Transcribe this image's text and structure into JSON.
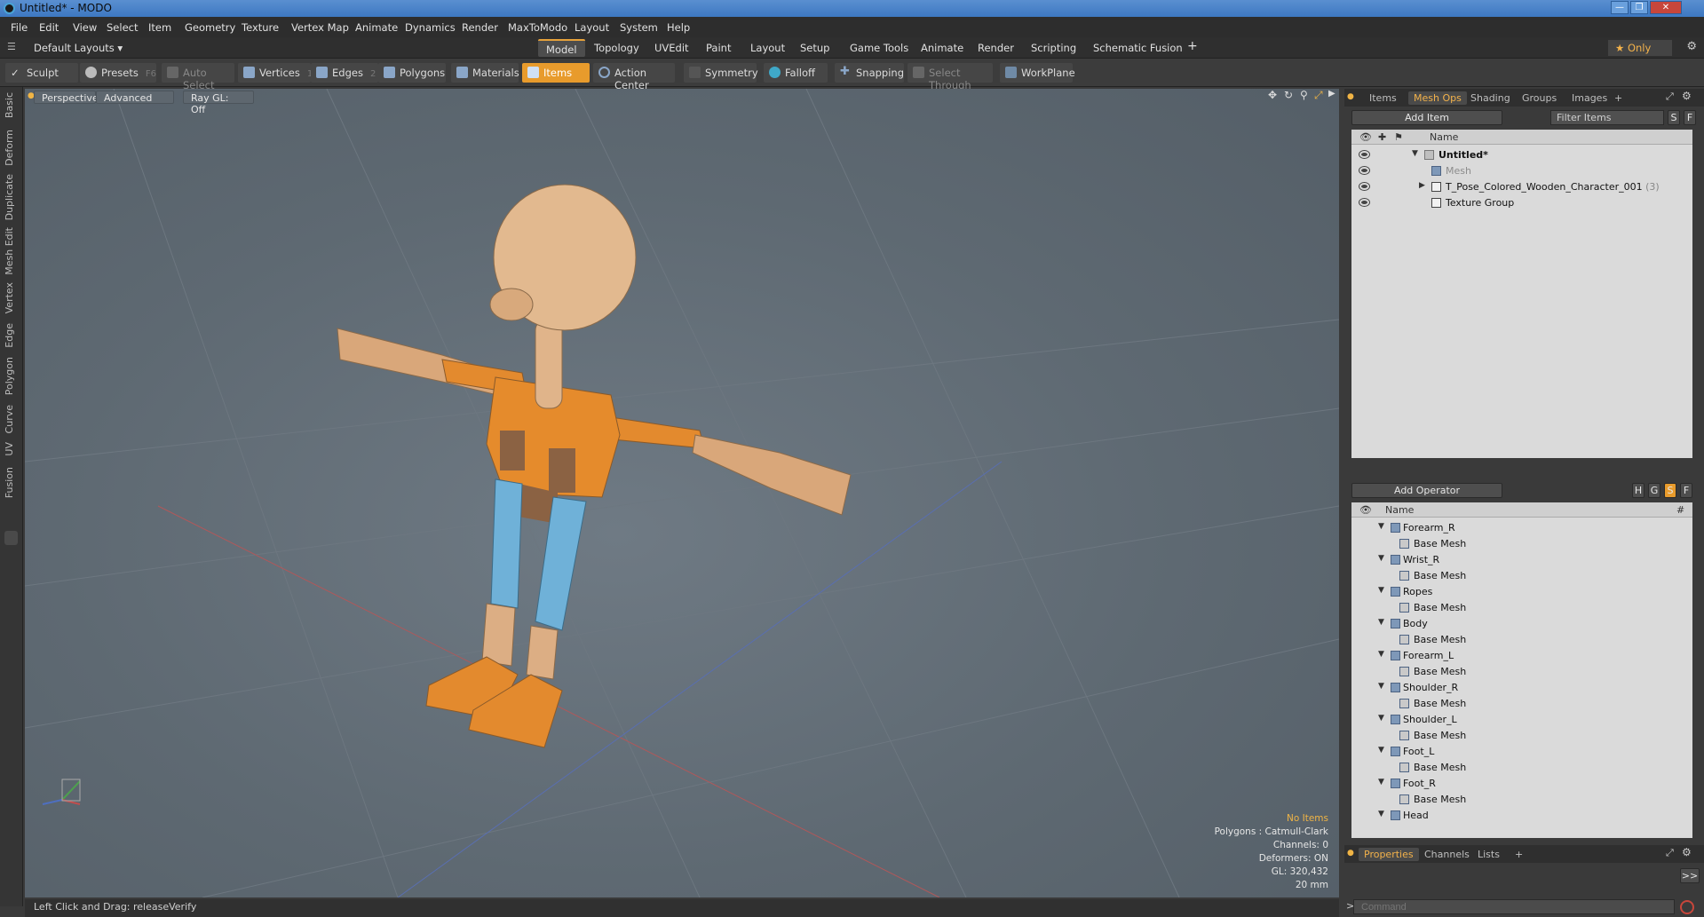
{
  "window": {
    "title": "Untitled* - MODO"
  },
  "menu": [
    "File",
    "Edit",
    "View",
    "Select",
    "Item",
    "Geometry",
    "Texture",
    "Vertex Map",
    "Animate",
    "Dynamics",
    "Render",
    "MaxToModo",
    "Layout",
    "System",
    "Help"
  ],
  "layouts": {
    "dropdown": "Default Layouts ▾",
    "tabs": [
      "Model",
      "Topology",
      "UVEdit",
      "Paint",
      "Layout",
      "Setup",
      "Game Tools",
      "Animate",
      "Render",
      "Scripting",
      "Schematic Fusion"
    ],
    "active": "Model",
    "add": "+",
    "only": "★  Only"
  },
  "toolbar": {
    "sculpt": "Sculpt",
    "presets": "Presets",
    "presets_key": "F6",
    "auto_select": "Auto Select",
    "vertices": "Vertices",
    "vertices_count": "1",
    "edges": "Edges",
    "edges_count": "2",
    "polygons": "Polygons",
    "materials": "Materials",
    "items": "Items",
    "action_center": "Action Center",
    "symmetry": "Symmetry",
    "falloff": "Falloff",
    "snapping": "Snapping",
    "select_through": "Select Through",
    "workplane": "WorkPlane"
  },
  "left_tabs": [
    "Basic",
    "Deform",
    "Duplicate",
    "Mesh Edit",
    "Vertex",
    "Edge",
    "Polygon",
    "Curve",
    "UV",
    "Fusion"
  ],
  "viewport": {
    "view": "Perspective",
    "shading": "Advanced",
    "raygl": "Ray GL: Off",
    "info": {
      "no_items": "No Items",
      "polygons": "Polygons : Catmull-Clark",
      "channels": "Channels: 0",
      "deformers": "Deformers: ON",
      "gl": "GL: 320,432",
      "grid": "20 mm"
    },
    "status": "Left Click and Drag:  releaseVerify"
  },
  "items_panel": {
    "tabs": [
      "Items",
      "Mesh Ops",
      "Shading",
      "Groups",
      "Images",
      "+"
    ],
    "active": "Mesh Ops",
    "add_item": "Add Item",
    "filter": "Filter Items",
    "s": "S",
    "f": "F",
    "col_name": "Name",
    "rows": [
      {
        "label": "Untitled*"
      },
      {
        "label": "Mesh"
      },
      {
        "label": "T_Pose_Colored_Wooden_Character_001",
        "count": "(3)"
      },
      {
        "label": "Texture Group"
      }
    ]
  },
  "ops_panel": {
    "add_operator": "Add Operator",
    "col_name": "Name",
    "col_hash": "#",
    "flags": [
      "H",
      "G",
      "S",
      "F"
    ],
    "groups": [
      {
        "name": "Forearm_R",
        "child": "Base Mesh"
      },
      {
        "name": "Wrist_R",
        "child": "Base Mesh"
      },
      {
        "name": "Ropes",
        "child": "Base Mesh"
      },
      {
        "name": "Body",
        "child": "Base Mesh"
      },
      {
        "name": "Forearm_L",
        "child": "Base Mesh"
      },
      {
        "name": "Shoulder_R",
        "child": "Base Mesh"
      },
      {
        "name": "Shoulder_L",
        "child": "Base Mesh"
      },
      {
        "name": "Foot_L",
        "child": "Base Mesh"
      },
      {
        "name": "Foot_R",
        "child": "Base Mesh"
      },
      {
        "name": "Head",
        "child": ""
      }
    ]
  },
  "props_panel": {
    "tabs": [
      "Properties",
      "Channels",
      "Lists",
      "+"
    ],
    "active": "Properties",
    "expand": ">>"
  },
  "command": {
    "placeholder": "Command",
    "prompt": ">"
  }
}
